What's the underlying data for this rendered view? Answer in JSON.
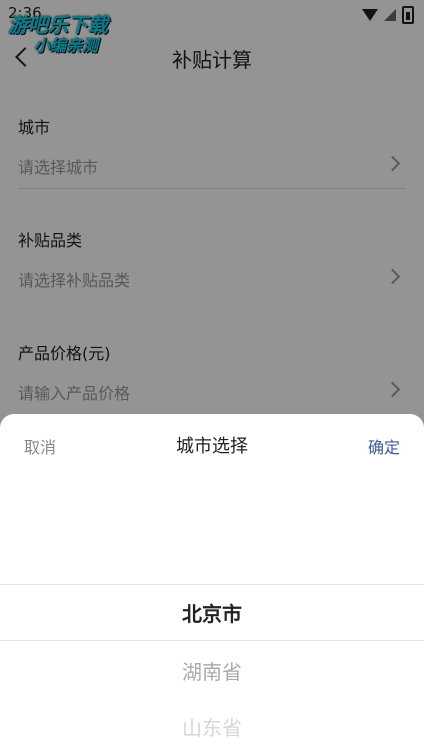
{
  "status": {
    "time": "2:36"
  },
  "watermark": {
    "line1": "游吧乐下载",
    "line2": "小编亲测"
  },
  "header": {
    "title": "补贴计算"
  },
  "form": {
    "fields": [
      {
        "label": "城市",
        "placeholder": "请选择城市"
      },
      {
        "label": "补贴品类",
        "placeholder": "请选择补贴品类"
      },
      {
        "label": "产品价格(元)",
        "placeholder": "请输入产品价格"
      }
    ]
  },
  "sheet": {
    "title": "城市选择",
    "cancel": "取消",
    "confirm": "确定",
    "options": [
      "北京市",
      "湖南省",
      "山东省"
    ],
    "selected_index": 0
  },
  "colors": {
    "confirm": "#3a5a99",
    "watermark": "#1ad3e6"
  }
}
